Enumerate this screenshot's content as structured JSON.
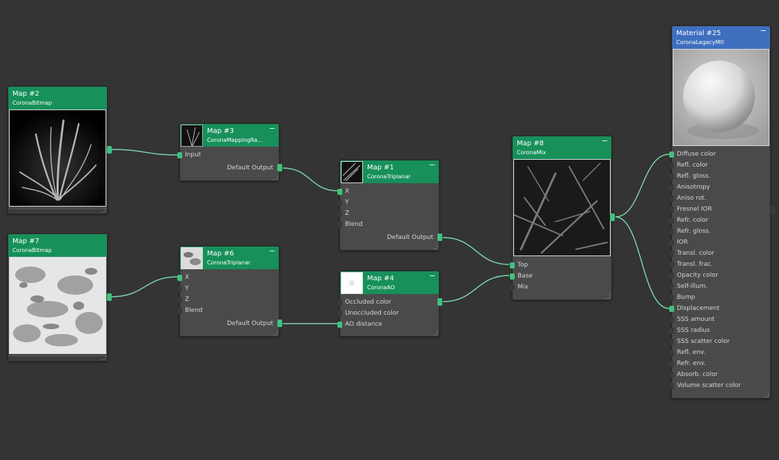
{
  "nodes": {
    "map2": {
      "title": "Map #2",
      "type": "CoronaBitmap"
    },
    "map7": {
      "title": "Map #7",
      "type": "CoronaBitmap"
    },
    "map3": {
      "title": "Map #3",
      "type": "CoronaMappingRa...",
      "inputs": [
        "Input"
      ],
      "output": "Default Output"
    },
    "map6": {
      "title": "Map #6",
      "type": "CoronaTriplanar",
      "inputs": [
        "X",
        "Y",
        "Z",
        "Blend"
      ],
      "output": "Default Output"
    },
    "map1": {
      "title": "Map #1",
      "type": "CoronaTriplanar",
      "inputs": [
        "X",
        "Y",
        "Z",
        "Blend"
      ],
      "output": "Default Output"
    },
    "map4": {
      "title": "Map #4",
      "type": "CoronaAO",
      "inputs": [
        "Occluded color",
        "Unoccluded color",
        "AO distance"
      ]
    },
    "map8": {
      "title": "Map #8",
      "type": "CoronaMix",
      "inputs": [
        "Top",
        "Base",
        "Mix"
      ]
    },
    "material": {
      "title": "Material #25",
      "type": "CoronaLegacyMtl",
      "inputs": [
        "Diffuse color",
        "Refl. color",
        "Refl. gloss.",
        "Anisotropy",
        "Aniso rot.",
        "Fresnel IOR",
        "Refr. color",
        "Refr. gloss.",
        "IOR",
        "Transl. color",
        "Transl. frac.",
        "Opacity color",
        "Self-illum.",
        "Bump",
        "Displacement",
        "SSS amount",
        "SSS radius",
        "SSS scatter color",
        "Refl. env.",
        "Refr. env.",
        "Absorb. color",
        "Volume scatter color"
      ]
    }
  },
  "colors": {
    "node_header": "#17905a",
    "material_header": "#3e6fbf",
    "wire": "#79d6a8",
    "port_connected": "#3fc27f"
  }
}
